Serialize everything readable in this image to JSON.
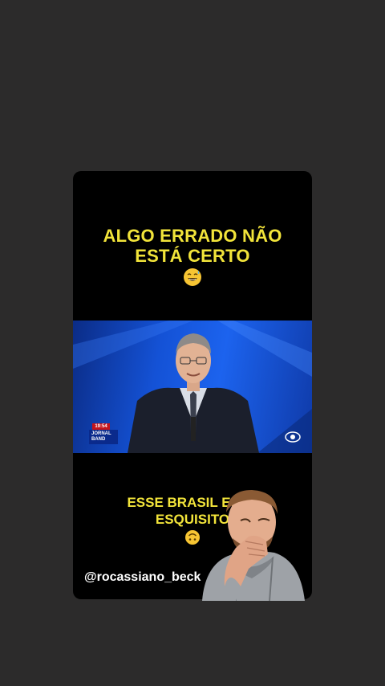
{
  "headline": {
    "line1": "ALGO ERRADO NÃO",
    "line2": "ESTÁ CERTO"
  },
  "caption": {
    "line1": "ESSE BRASIL ESTÁ",
    "line2": "ESQUISITO"
  },
  "handle": "@rocassiano_beck",
  "video": {
    "clock": "19:54",
    "program_line1": "JORNAL",
    "program_line2": "BAND"
  },
  "icons": [
    "grinning-sweat-emoji-icon",
    "upside-down-face-emoji-icon",
    "band-channel-logo-icon"
  ],
  "colors": {
    "background": "#2c2b2b",
    "card": "#000000",
    "text_yellow": "#f2e43a",
    "video_blue": "#1c63ee"
  }
}
